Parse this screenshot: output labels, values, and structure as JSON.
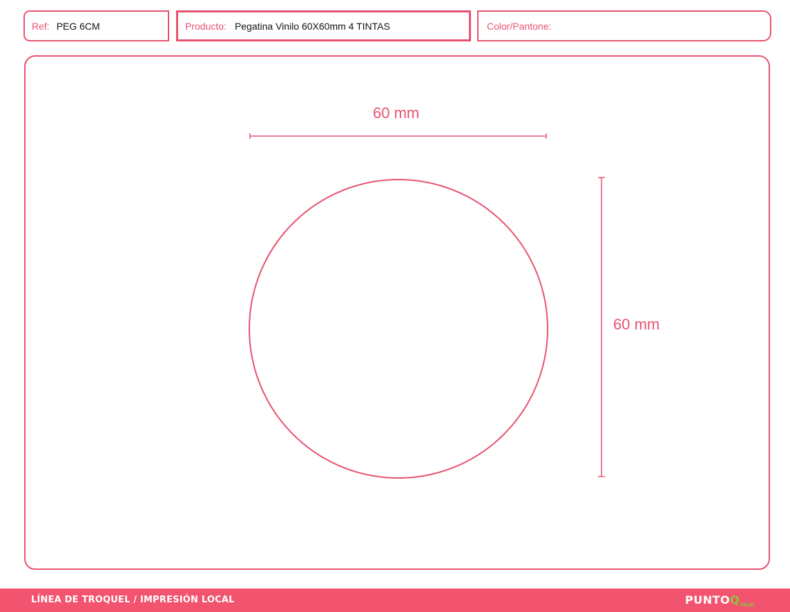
{
  "header": {
    "ref": {
      "label": "Ref:",
      "value": "PEG 6CM"
    },
    "product": {
      "label": "Producto:",
      "value": "Pegatina Vinilo 60X60mm 4 TINTAS"
    },
    "color": {
      "label": "Color/Pantone:",
      "value": ""
    }
  },
  "dieline": {
    "shape": "circle",
    "width_label": "60 mm",
    "height_label": "60 mm",
    "stroke_color": "#e8526f"
  },
  "footer": {
    "caption": "LÍNEA DE TROQUEL / IMPRESIÓN LOCAL",
    "logo_main": "PUNTO",
    "logo_q": "Q",
    "logo_sub": "PACK",
    "background_color": "#f2536e",
    "logo_accent_color": "#8cc63f"
  }
}
